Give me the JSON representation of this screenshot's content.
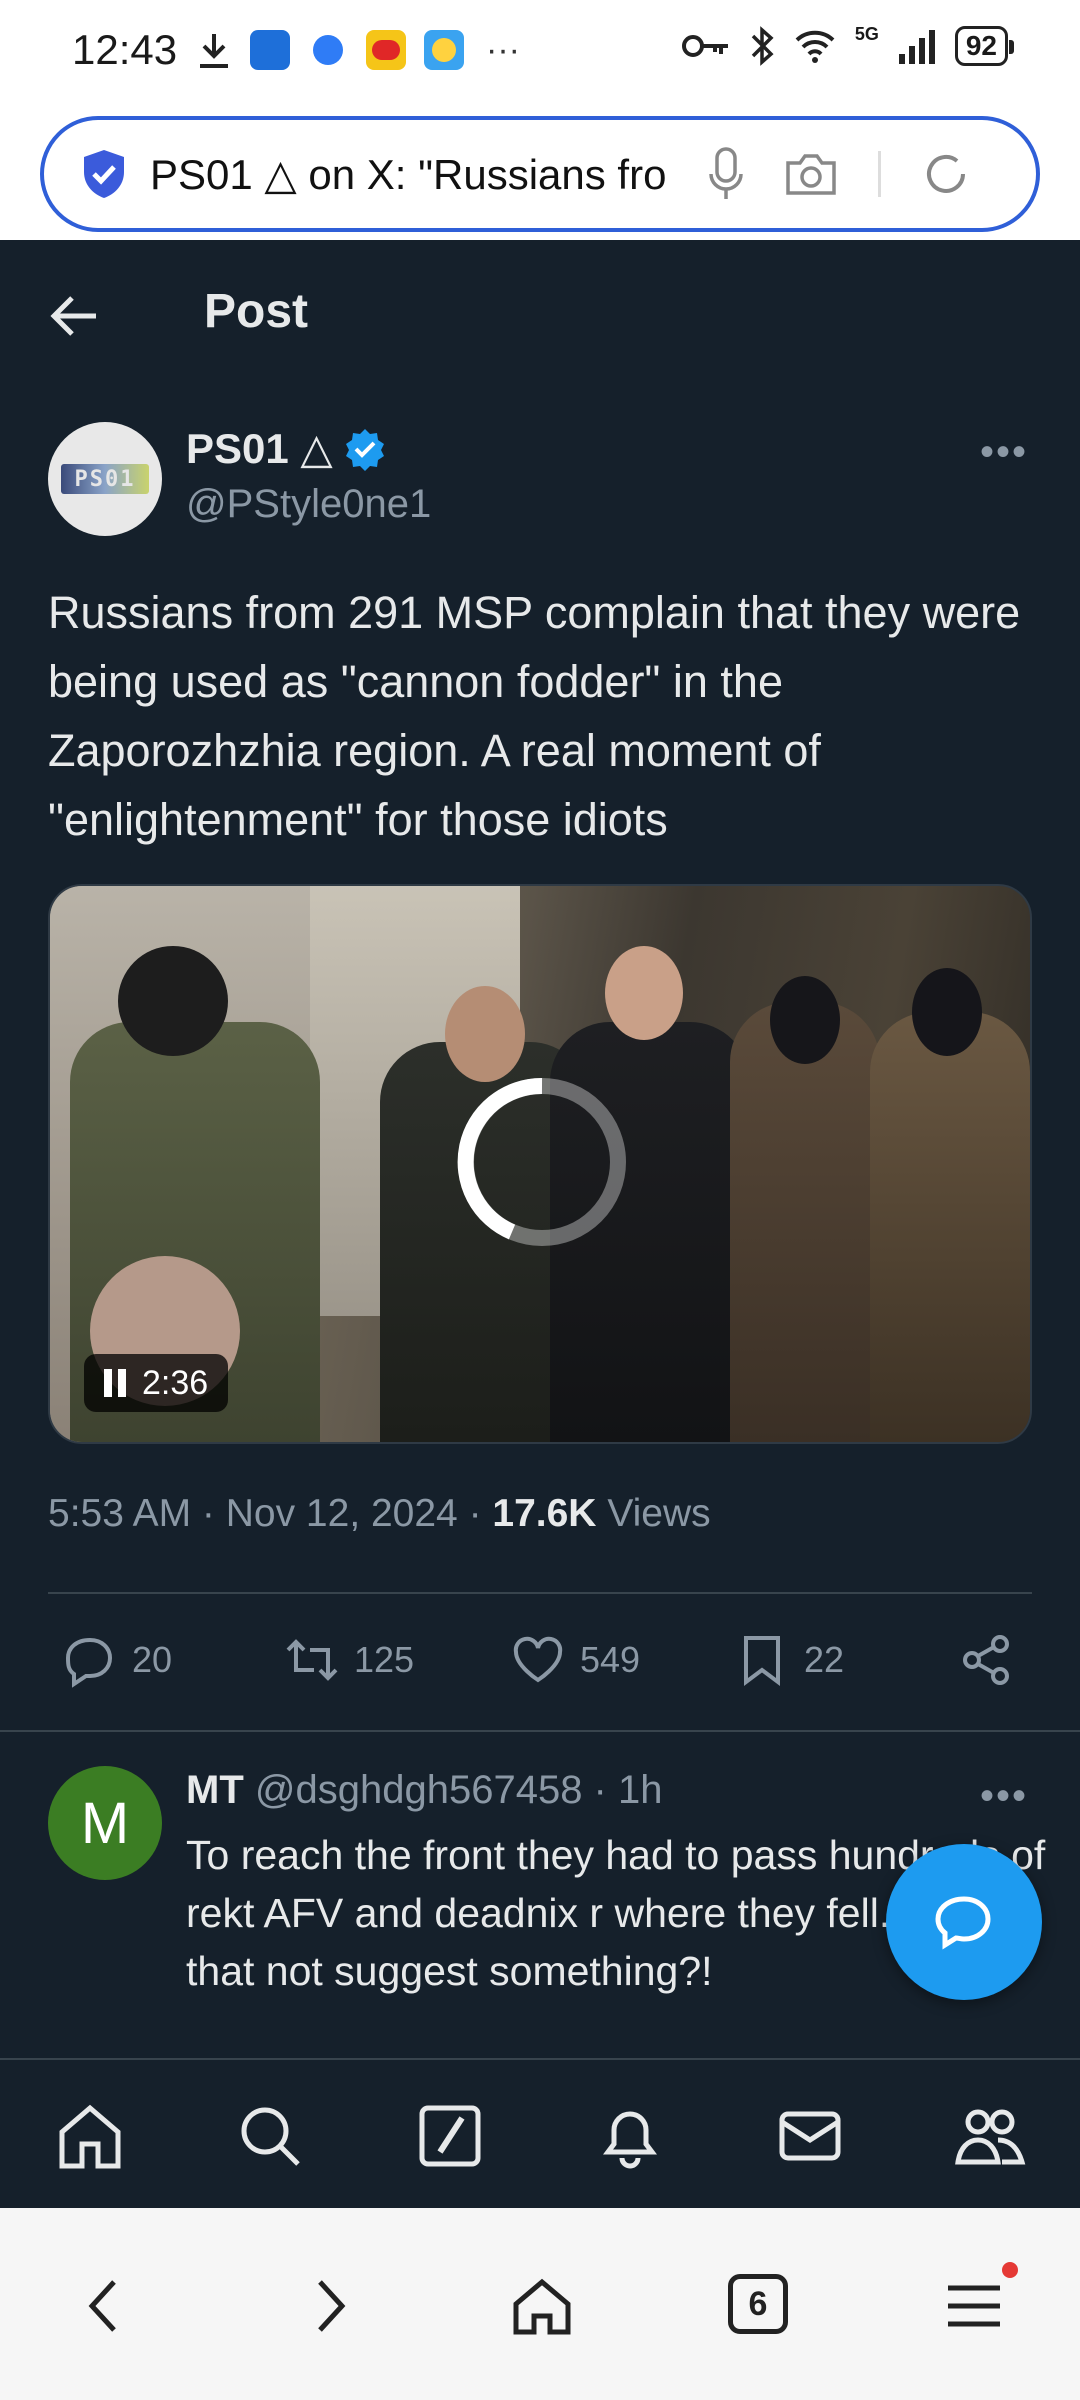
{
  "status_bar": {
    "time": "12:43",
    "network": "5G",
    "battery": "92",
    "more": "···"
  },
  "browser": {
    "url_text": "PS01 △ on X: \"Russians fro",
    "icons": [
      "shield-icon",
      "microphone-icon",
      "camera-icon",
      "refresh-icon"
    ]
  },
  "header": {
    "title": "Post"
  },
  "post": {
    "author_name": "PS01 △",
    "author_handle": "@PStyle0ne1",
    "avatar_text": "PS01",
    "text": "Russians from 291 MSP complain that they were being used as \"cannon fodder\" in the Zaporozhzhia region. A real moment of \"enlightenment\" for those idiots",
    "video_duration": "2:36",
    "time": "5:53 AM · Nov 12, 2024 · ",
    "views_count": "17.6K",
    "views_label": " Views",
    "replies": "20",
    "reposts": "125",
    "likes": "549",
    "bookmarks": "22"
  },
  "reply": {
    "avatar_letter": "M",
    "name": "MT",
    "handle_time": " @dsghdgh567458 · 1h",
    "text": "To reach the front they had to pass hundreds of rekt AFV and deadnix r where they fell...did that not suggest something?!"
  },
  "system_nav": {
    "tabs_count": "6"
  },
  "colors": {
    "background": "#15202b",
    "accent": "#1d9bf0",
    "muted": "#8b98a5"
  }
}
